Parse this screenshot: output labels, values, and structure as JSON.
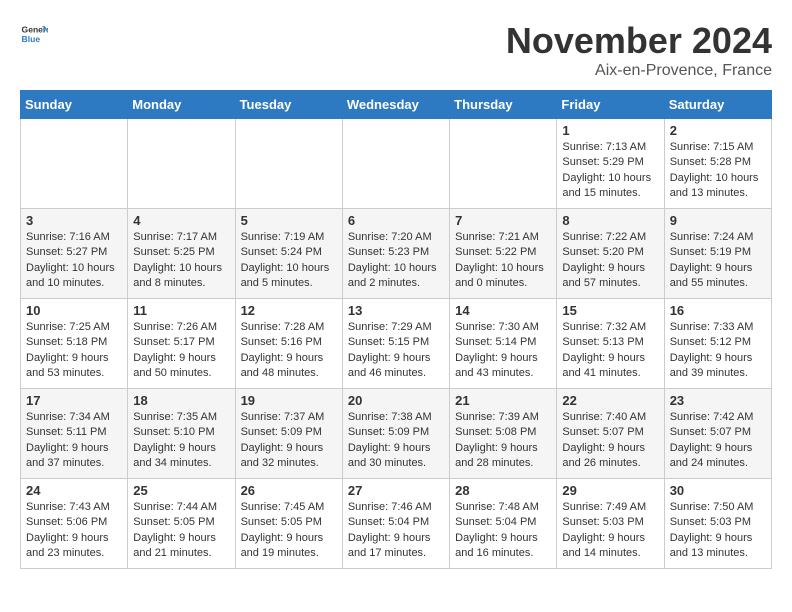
{
  "logo": {
    "text_general": "General",
    "text_blue": "Blue",
    "tagline": "GeneralBlue"
  },
  "title": {
    "month_year": "November 2024",
    "location": "Aix-en-Provence, France"
  },
  "header_days": [
    "Sunday",
    "Monday",
    "Tuesday",
    "Wednesday",
    "Thursday",
    "Friday",
    "Saturday"
  ],
  "weeks": [
    [
      {
        "day": "",
        "info": ""
      },
      {
        "day": "",
        "info": ""
      },
      {
        "day": "",
        "info": ""
      },
      {
        "day": "",
        "info": ""
      },
      {
        "day": "",
        "info": ""
      },
      {
        "day": "1",
        "info": "Sunrise: 7:13 AM\nSunset: 5:29 PM\nDaylight: 10 hours\nand 15 minutes."
      },
      {
        "day": "2",
        "info": "Sunrise: 7:15 AM\nSunset: 5:28 PM\nDaylight: 10 hours\nand 13 minutes."
      }
    ],
    [
      {
        "day": "3",
        "info": "Sunrise: 7:16 AM\nSunset: 5:27 PM\nDaylight: 10 hours\nand 10 minutes."
      },
      {
        "day": "4",
        "info": "Sunrise: 7:17 AM\nSunset: 5:25 PM\nDaylight: 10 hours\nand 8 minutes."
      },
      {
        "day": "5",
        "info": "Sunrise: 7:19 AM\nSunset: 5:24 PM\nDaylight: 10 hours\nand 5 minutes."
      },
      {
        "day": "6",
        "info": "Sunrise: 7:20 AM\nSunset: 5:23 PM\nDaylight: 10 hours\nand 2 minutes."
      },
      {
        "day": "7",
        "info": "Sunrise: 7:21 AM\nSunset: 5:22 PM\nDaylight: 10 hours\nand 0 minutes."
      },
      {
        "day": "8",
        "info": "Sunrise: 7:22 AM\nSunset: 5:20 PM\nDaylight: 9 hours\nand 57 minutes."
      },
      {
        "day": "9",
        "info": "Sunrise: 7:24 AM\nSunset: 5:19 PM\nDaylight: 9 hours\nand 55 minutes."
      }
    ],
    [
      {
        "day": "10",
        "info": "Sunrise: 7:25 AM\nSunset: 5:18 PM\nDaylight: 9 hours\nand 53 minutes."
      },
      {
        "day": "11",
        "info": "Sunrise: 7:26 AM\nSunset: 5:17 PM\nDaylight: 9 hours\nand 50 minutes."
      },
      {
        "day": "12",
        "info": "Sunrise: 7:28 AM\nSunset: 5:16 PM\nDaylight: 9 hours\nand 48 minutes."
      },
      {
        "day": "13",
        "info": "Sunrise: 7:29 AM\nSunset: 5:15 PM\nDaylight: 9 hours\nand 46 minutes."
      },
      {
        "day": "14",
        "info": "Sunrise: 7:30 AM\nSunset: 5:14 PM\nDaylight: 9 hours\nand 43 minutes."
      },
      {
        "day": "15",
        "info": "Sunrise: 7:32 AM\nSunset: 5:13 PM\nDaylight: 9 hours\nand 41 minutes."
      },
      {
        "day": "16",
        "info": "Sunrise: 7:33 AM\nSunset: 5:12 PM\nDaylight: 9 hours\nand 39 minutes."
      }
    ],
    [
      {
        "day": "17",
        "info": "Sunrise: 7:34 AM\nSunset: 5:11 PM\nDaylight: 9 hours\nand 37 minutes."
      },
      {
        "day": "18",
        "info": "Sunrise: 7:35 AM\nSunset: 5:10 PM\nDaylight: 9 hours\nand 34 minutes."
      },
      {
        "day": "19",
        "info": "Sunrise: 7:37 AM\nSunset: 5:09 PM\nDaylight: 9 hours\nand 32 minutes."
      },
      {
        "day": "20",
        "info": "Sunrise: 7:38 AM\nSunset: 5:09 PM\nDaylight: 9 hours\nand 30 minutes."
      },
      {
        "day": "21",
        "info": "Sunrise: 7:39 AM\nSunset: 5:08 PM\nDaylight: 9 hours\nand 28 minutes."
      },
      {
        "day": "22",
        "info": "Sunrise: 7:40 AM\nSunset: 5:07 PM\nDaylight: 9 hours\nand 26 minutes."
      },
      {
        "day": "23",
        "info": "Sunrise: 7:42 AM\nSunset: 5:07 PM\nDaylight: 9 hours\nand 24 minutes."
      }
    ],
    [
      {
        "day": "24",
        "info": "Sunrise: 7:43 AM\nSunset: 5:06 PM\nDaylight: 9 hours\nand 23 minutes."
      },
      {
        "day": "25",
        "info": "Sunrise: 7:44 AM\nSunset: 5:05 PM\nDaylight: 9 hours\nand 21 minutes."
      },
      {
        "day": "26",
        "info": "Sunrise: 7:45 AM\nSunset: 5:05 PM\nDaylight: 9 hours\nand 19 minutes."
      },
      {
        "day": "27",
        "info": "Sunrise: 7:46 AM\nSunset: 5:04 PM\nDaylight: 9 hours\nand 17 minutes."
      },
      {
        "day": "28",
        "info": "Sunrise: 7:48 AM\nSunset: 5:04 PM\nDaylight: 9 hours\nand 16 minutes."
      },
      {
        "day": "29",
        "info": "Sunrise: 7:49 AM\nSunset: 5:03 PM\nDaylight: 9 hours\nand 14 minutes."
      },
      {
        "day": "30",
        "info": "Sunrise: 7:50 AM\nSunset: 5:03 PM\nDaylight: 9 hours\nand 13 minutes."
      }
    ]
  ]
}
